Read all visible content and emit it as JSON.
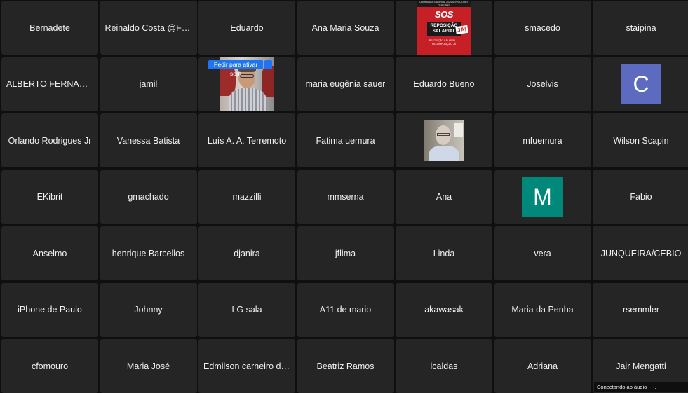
{
  "participants": [
    [
      "Bernadete",
      "Reinaldo Costa @Fortaleza",
      "Eduardo",
      "Ana Maria Souza",
      "",
      "smacedo",
      "staipina"
    ],
    [
      "ALBERTO FERNANDO",
      "jamil",
      "",
      "maria eugênia sauer",
      "Eduardo Bueno",
      "Joselvis",
      ""
    ],
    [
      "Orlando Rodrigues Jr",
      "Vanessa Batista",
      "Luís A. A. Terremoto",
      "Fatima uemura",
      "",
      "mfuemura",
      "Wilson Scapin"
    ],
    [
      "EKibrit",
      "gmachado",
      "mazzilli",
      "mmserna",
      "Ana",
      "",
      "Fabio"
    ],
    [
      "Anselmo",
      "henrique Barcellos",
      "djanira",
      "jflima",
      "Linda",
      "vera",
      "JUNQUEIRA/CEBIO"
    ],
    [
      "iPhone de Paulo",
      "Johnny",
      "LG sala",
      "A11 de mario",
      "akawasak",
      "Maria da Penha",
      "rsemmler"
    ],
    [
      "cfomouro",
      "Maria José",
      "Edmilson carneiro de Souza",
      "Beatriz Ramos",
      "lcaldas",
      "Adriana",
      "Jair Mengatti"
    ]
  ],
  "poster": {
    "top_text": "CAMPANHA SALARIAL 2024 SERVIDORES FEDERAIS",
    "sos": "SOS",
    "title_line1": "REPOSIÇÃO",
    "title_line2": "SALARIAL",
    "ja": "JÁ!",
    "fine_print": "RESTRIÇÃO SALARIAL — RECOMPOSIÇÃO JÁ"
  },
  "video_overlay": {
    "unmute_label": "Pedir para ativar som",
    "more_label": "···"
  },
  "avatars": {
    "c": {
      "letter": "C",
      "color": "#5c6bc0"
    },
    "m": {
      "letter": "M",
      "color": "#00897b"
    }
  },
  "status": {
    "text": "Conectando ao áudio",
    "dots": "·-."
  }
}
